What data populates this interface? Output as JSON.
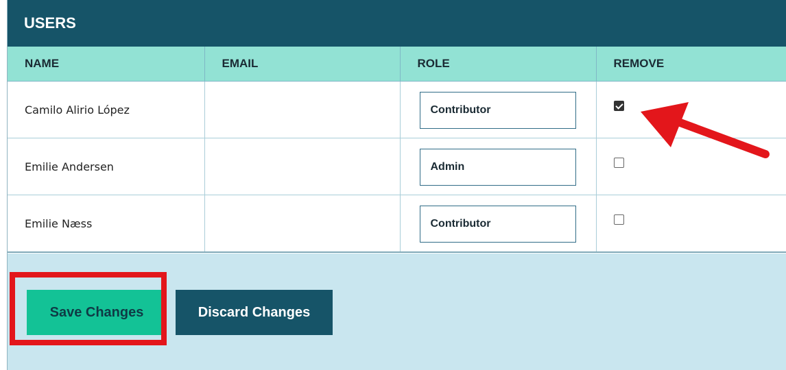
{
  "panel": {
    "title": "USERS"
  },
  "table": {
    "headers": {
      "name": "NAME",
      "email": "EMAIL",
      "role": "ROLE",
      "remove": "REMOVE"
    },
    "rows": [
      {
        "name": "Camilo Alirio López",
        "email": "",
        "role": "Contributor",
        "remove": true
      },
      {
        "name": "Emilie Andersen",
        "email": "",
        "role": "Admin",
        "remove": false
      },
      {
        "name": "Emilie Næss",
        "email": "",
        "role": "Contributor",
        "remove": false
      }
    ]
  },
  "actions": {
    "save_label": "Save Changes",
    "discard_label": "Discard Changes"
  },
  "annotations": {
    "highlight_color": "#e3161b",
    "arrow_color": "#e3161b"
  },
  "colors": {
    "header_bg": "#165468",
    "column_header_bg": "#92e2d4",
    "footer_bg": "#c9e6ef",
    "save_button_bg": "#13c296",
    "discard_button_bg": "#165468"
  }
}
